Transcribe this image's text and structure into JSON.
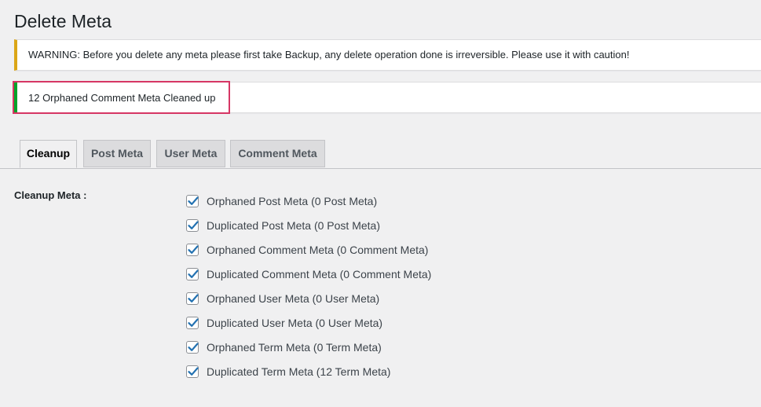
{
  "page": {
    "title": "Delete Meta"
  },
  "notices": {
    "warning": "WARNING: Before you delete any meta please first take Backup, any delete operation done is irreversible. Please use it with caution!",
    "success": "12 Orphaned Comment Meta Cleaned up"
  },
  "tabs": [
    {
      "label": "Cleanup",
      "active": true
    },
    {
      "label": "Post Meta",
      "active": false
    },
    {
      "label": "User Meta",
      "active": false
    },
    {
      "label": "Comment Meta",
      "active": false
    }
  ],
  "cleanup": {
    "label": "Cleanup Meta :",
    "options": [
      {
        "label": "Orphaned Post Meta (0 Post Meta)",
        "checked": true
      },
      {
        "label": "Duplicated Post Meta (0 Post Meta)",
        "checked": true
      },
      {
        "label": "Orphaned Comment Meta (0 Comment Meta)",
        "checked": true
      },
      {
        "label": "Duplicated Comment Meta (0 Comment Meta)",
        "checked": true
      },
      {
        "label": "Orphaned User Meta (0 User Meta)",
        "checked": true
      },
      {
        "label": "Duplicated User Meta (0 User Meta)",
        "checked": true
      },
      {
        "label": "Orphaned Term Meta (0 Term Meta)",
        "checked": true
      },
      {
        "label": "Duplicated Term Meta (12 Term Meta)",
        "checked": true
      }
    ]
  },
  "colors": {
    "warning_border": "#dba617",
    "success_border": "#00a32a",
    "highlight": "#d63664",
    "checkmark": "#2271b1"
  }
}
